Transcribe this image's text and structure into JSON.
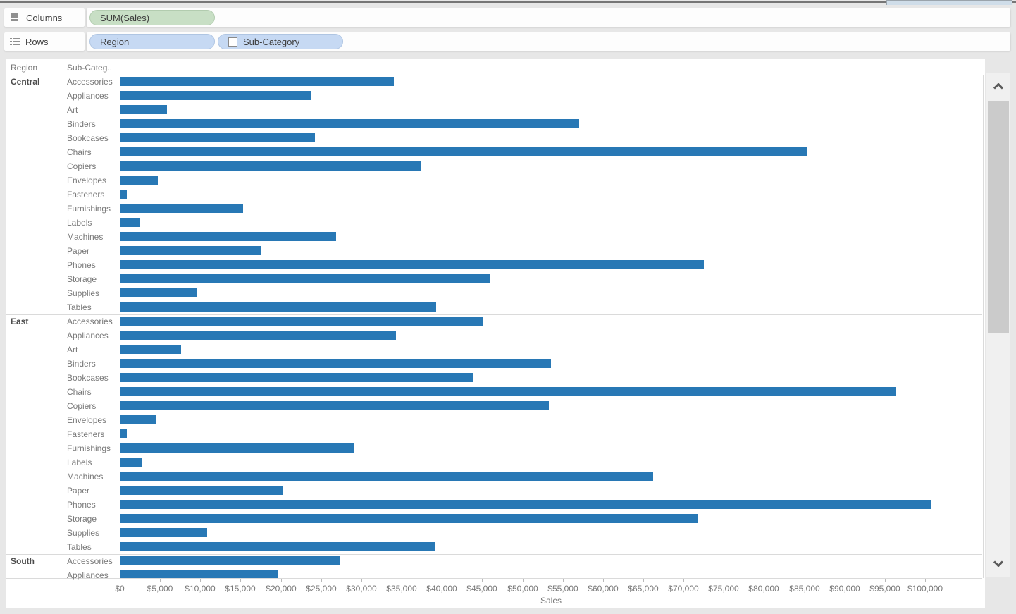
{
  "shelves": {
    "columns": {
      "label": "Columns",
      "icon": "grid-columns-icon",
      "pills": [
        {
          "label": "SUM(Sales)",
          "kind": "measure",
          "color": "#c8dfc5"
        }
      ]
    },
    "rows": {
      "label": "Rows",
      "icon": "list-rows-icon",
      "pills": [
        {
          "label": "Region",
          "kind": "dimension",
          "color": "#c6d9f3"
        },
        {
          "label": "Sub-Category",
          "kind": "dimension",
          "color": "#c6d9f3",
          "expand_icon": "expand-plus-icon"
        }
      ]
    }
  },
  "table": {
    "region_header": "Region",
    "subcategory_header": "Sub-Categ.."
  },
  "chart_data": {
    "type": "bar",
    "orientation": "horizontal",
    "bar_color": "#2878b5",
    "xlabel": "Sales",
    "xlim": [
      0,
      107000
    ],
    "grid": false,
    "axis_tick_values": [
      0,
      5000,
      10000,
      15000,
      20000,
      25000,
      30000,
      35000,
      40000,
      45000,
      50000,
      55000,
      60000,
      65000,
      70000,
      75000,
      80000,
      85000,
      90000,
      95000,
      100000
    ],
    "axis_tick_labels": [
      "$0",
      "$5,000",
      "$10,000",
      "$15,000",
      "$20,000",
      "$25,000",
      "$30,000",
      "$35,000",
      "$40,000",
      "$45,000",
      "$50,000",
      "$55,000",
      "$60,000",
      "$65,000",
      "$70,000",
      "$75,000",
      "$80,000",
      "$85,000",
      "$90,000",
      "$95,000",
      "$100,000"
    ],
    "groups": [
      {
        "region": "Central",
        "rows": [
          {
            "label": "Accessories",
            "value": 33956
          },
          {
            "label": "Appliances",
            "value": 23582
          },
          {
            "label": "Art",
            "value": 5765
          },
          {
            "label": "Binders",
            "value": 56923
          },
          {
            "label": "Bookcases",
            "value": 24157
          },
          {
            "label": "Chairs",
            "value": 85231
          },
          {
            "label": "Copiers",
            "value": 37260
          },
          {
            "label": "Envelopes",
            "value": 4637
          },
          {
            "label": "Fasteners",
            "value": 778
          },
          {
            "label": "Furnishings",
            "value": 15254
          },
          {
            "label": "Labels",
            "value": 2451
          },
          {
            "label": "Machines",
            "value": 26797
          },
          {
            "label": "Paper",
            "value": 17492
          },
          {
            "label": "Phones",
            "value": 72403
          },
          {
            "label": "Storage",
            "value": 45930
          },
          {
            "label": "Supplies",
            "value": 9467
          },
          {
            "label": "Tables",
            "value": 39155
          }
        ]
      },
      {
        "region": "East",
        "rows": [
          {
            "label": "Accessories",
            "value": 45033
          },
          {
            "label": "Appliances",
            "value": 34188
          },
          {
            "label": "Art",
            "value": 7486
          },
          {
            "label": "Binders",
            "value": 53498
          },
          {
            "label": "Bookcases",
            "value": 43819
          },
          {
            "label": "Chairs",
            "value": 96261
          },
          {
            "label": "Copiers",
            "value": 53219
          },
          {
            "label": "Envelopes",
            "value": 4376
          },
          {
            "label": "Fasteners",
            "value": 820
          },
          {
            "label": "Furnishings",
            "value": 29071
          },
          {
            "label": "Labels",
            "value": 2603
          },
          {
            "label": "Machines",
            "value": 66106
          },
          {
            "label": "Paper",
            "value": 20172
          },
          {
            "label": "Phones",
            "value": 100615
          },
          {
            "label": "Storage",
            "value": 71613
          },
          {
            "label": "Supplies",
            "value": 10760
          },
          {
            "label": "Tables",
            "value": 39140
          }
        ]
      },
      {
        "region": "South",
        "rows": [
          {
            "label": "Accessories",
            "value": 27277
          },
          {
            "label": "Appliances",
            "value": 19525
          }
        ]
      }
    ]
  },
  "scrollbar": {
    "up_icon": "chevron-up-icon",
    "down_icon": "chevron-down-icon"
  }
}
